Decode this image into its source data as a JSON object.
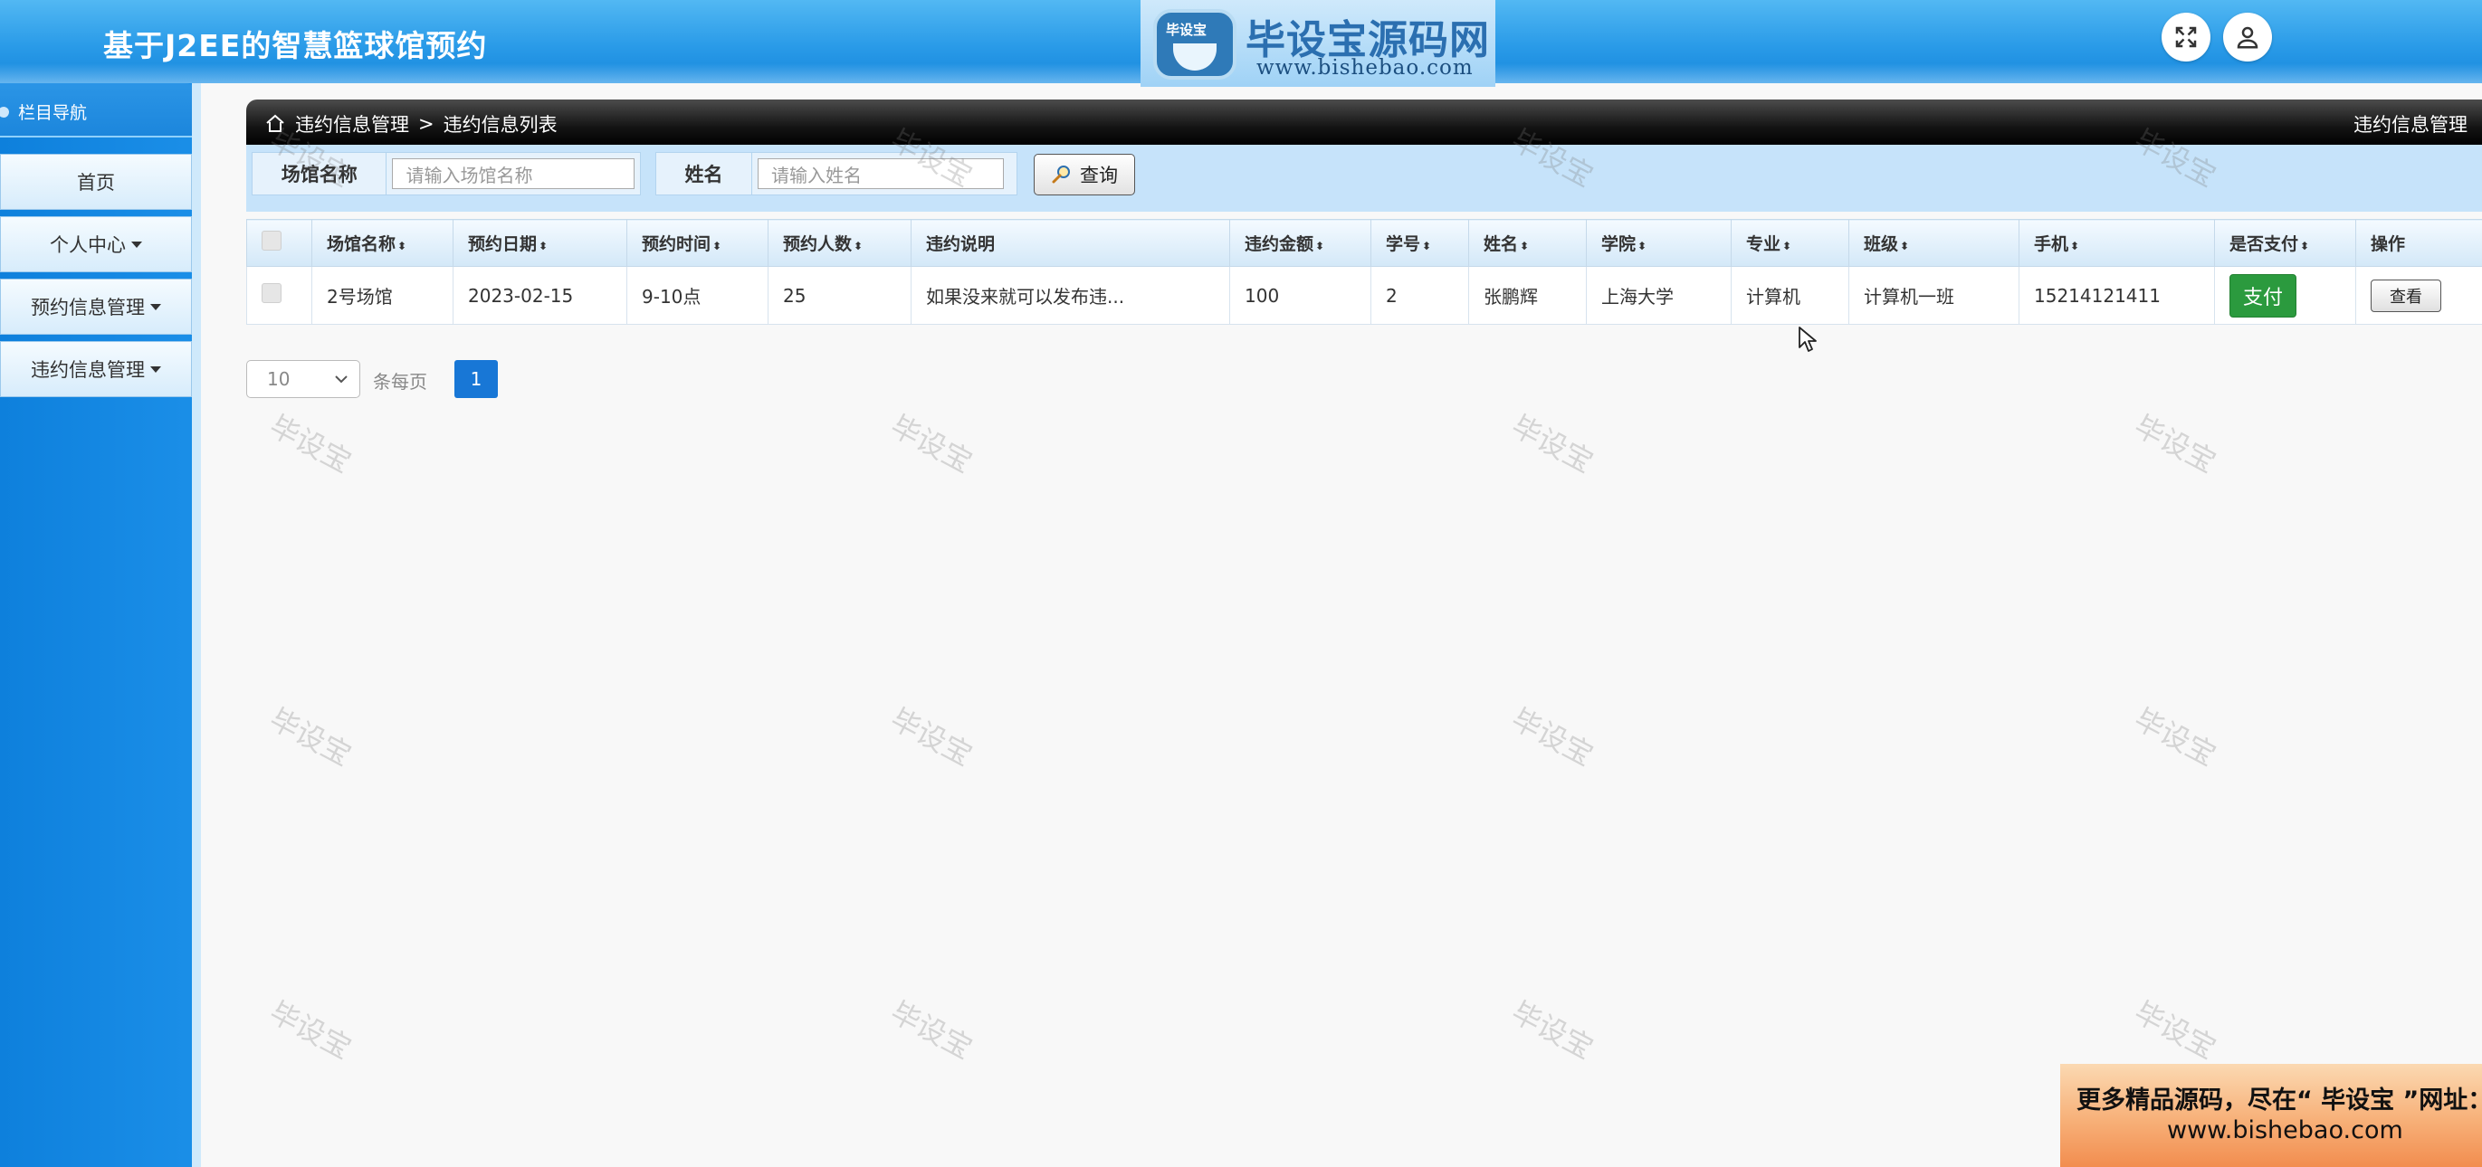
{
  "header": {
    "app_title": "基于J2EE的智慧篮球馆预约",
    "logo_badge": "毕设宝",
    "logo_title": "毕设宝源码网",
    "logo_url": "www.bishebao.com"
  },
  "sidebar": {
    "title": "栏目导航",
    "items": [
      {
        "label": "首页",
        "has_caret": false
      },
      {
        "label": "个人中心",
        "has_caret": true
      },
      {
        "label": "预约信息管理",
        "has_caret": true
      },
      {
        "label": "违约信息管理",
        "has_caret": true
      }
    ]
  },
  "breadcrumb": {
    "section": "违约信息管理",
    "separator": ">",
    "page": "违约信息列表",
    "right_title": "违约信息管理"
  },
  "search": {
    "venue_label": "场馆名称",
    "venue_placeholder": "请输入场馆名称",
    "name_label": "姓名",
    "name_placeholder": "请输入姓名",
    "search_button": "查询"
  },
  "table": {
    "columns": [
      "场馆名称",
      "预约日期",
      "预约时间",
      "预约人数",
      "违约说明",
      "违约金额",
      "学号",
      "姓名",
      "学院",
      "专业",
      "班级",
      "手机",
      "是否支付",
      "操作"
    ],
    "rows": [
      {
        "venue": "2号场馆",
        "date": "2023-02-15",
        "time": "9-10点",
        "people": "25",
        "description": "如果没来就可以发布违...",
        "amount": "100",
        "student_id": "2",
        "name": "张鹏辉",
        "college": "上海大学",
        "major": "计算机",
        "class": "计算机一班",
        "phone": "15214121411",
        "pay_label": "支付",
        "view_label": "查看"
      }
    ]
  },
  "pagination": {
    "page_size": "10",
    "per_page_label": "条每页",
    "current_page": "1"
  },
  "watermark": "毕设宝",
  "promo": {
    "line1": "更多精品源码，尽在“ 毕设宝 ”网址：",
    "line2": "www.bishebao.com"
  },
  "colors": {
    "header_blue": "#2a9be8",
    "sidebar_blue": "#1587e2",
    "pay_green": "#2b9a3e",
    "page_active": "#1877d6"
  }
}
